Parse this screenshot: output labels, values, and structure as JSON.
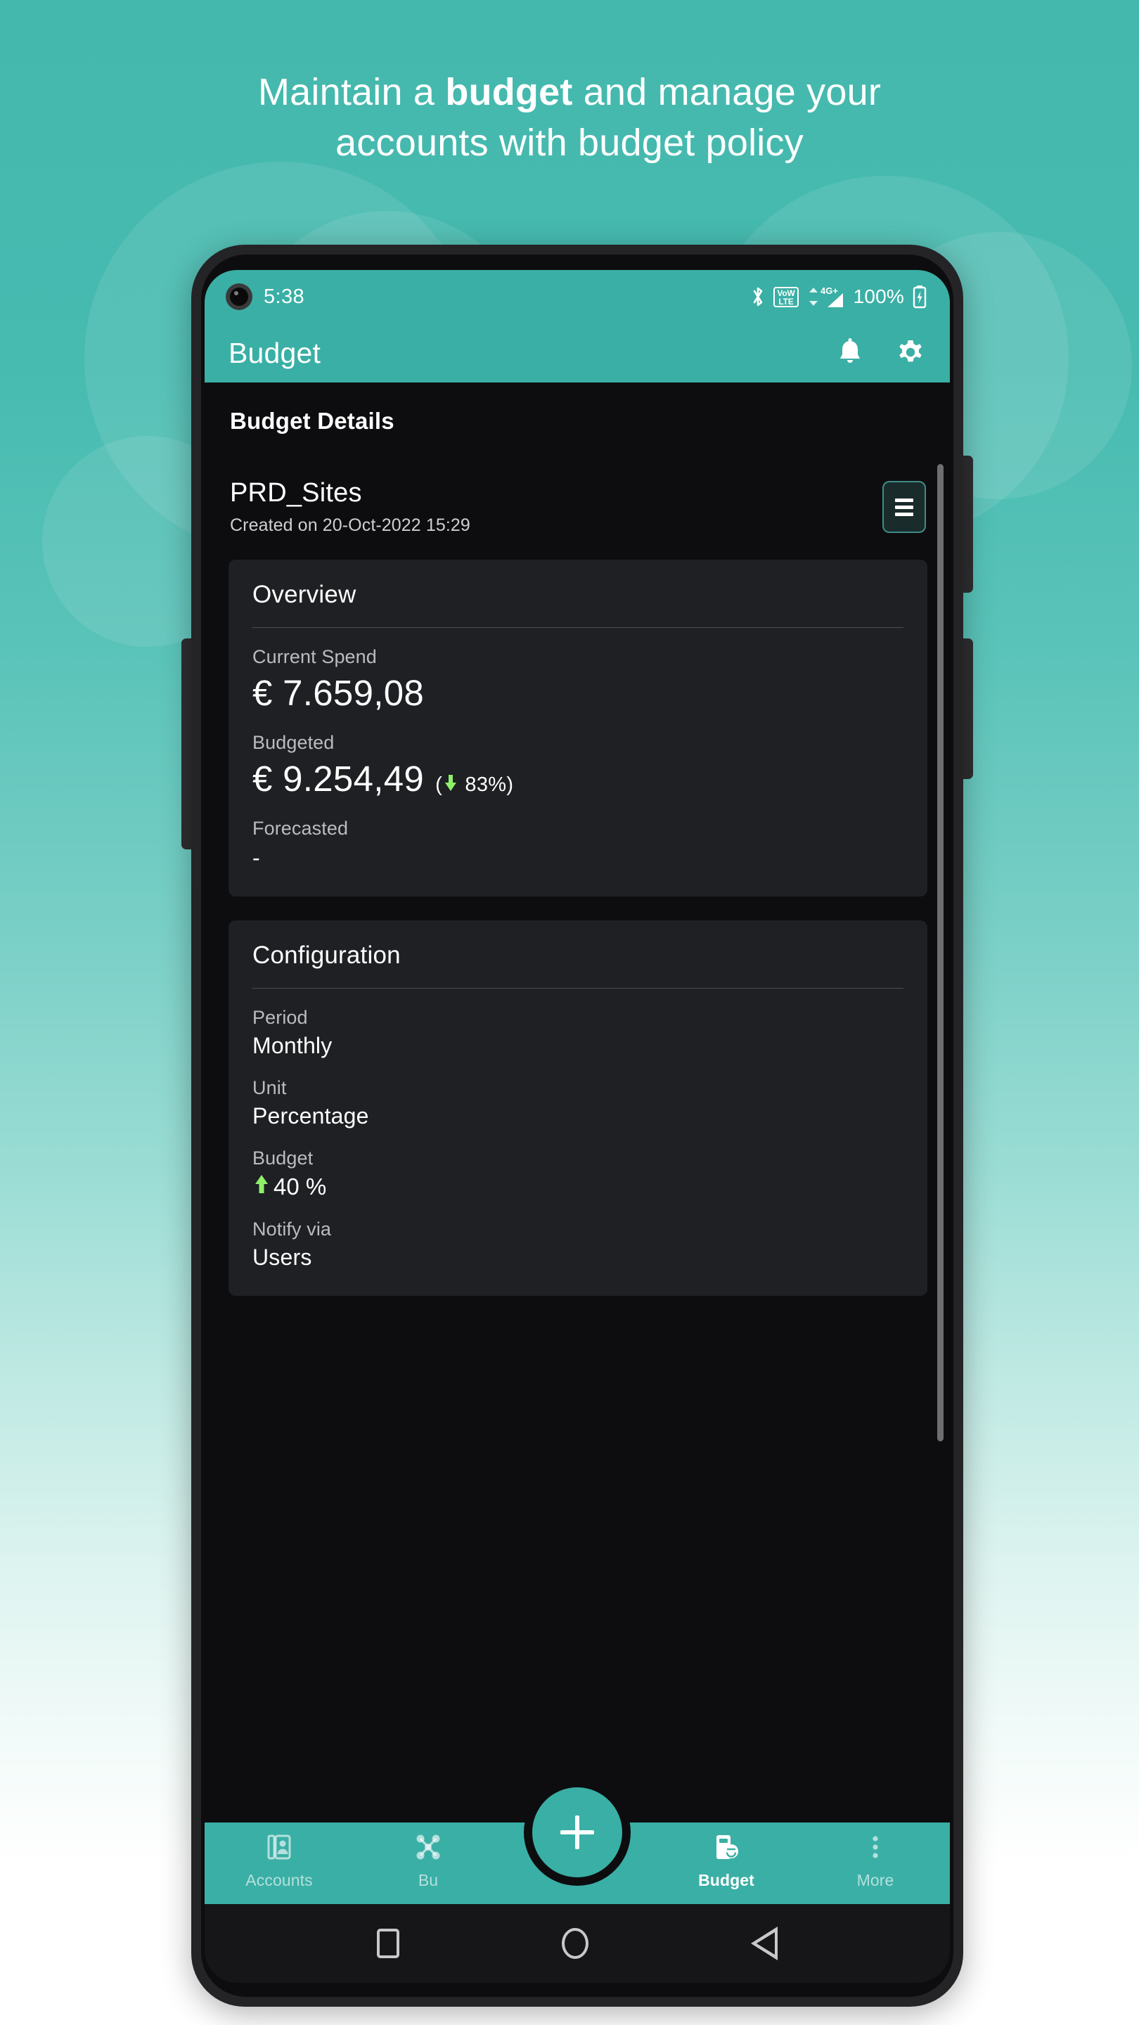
{
  "promo": {
    "headline_line1_pre": "Maintain a ",
    "headline_line1_bold": "budget",
    "headline_line1_post": " and manage your",
    "headline_line2": "accounts with budget policy"
  },
  "colors": {
    "brand_teal": "#3aafa5",
    "background_teal": "#45b8ae",
    "card_bg": "#1e2023",
    "screen_bg": "#0d0d10",
    "positive_green": "#8ef06a"
  },
  "status_bar": {
    "time": "5:38",
    "battery_percent": "100%",
    "network_label": "4G+",
    "volte_top": "VoW",
    "volte_bottom": "LTE",
    "icons": [
      "camera-hole-icon",
      "bluetooth-icon",
      "volte-icon",
      "signal-4gplus-icon",
      "battery-charging-icon"
    ]
  },
  "app_bar": {
    "title": "Budget",
    "actions": [
      {
        "name": "notifications-bell-icon",
        "label": "Notifications"
      },
      {
        "name": "settings-gear-icon",
        "label": "Settings"
      }
    ]
  },
  "screen": {
    "section_title": "Budget Details",
    "budget": {
      "name": "PRD_Sites",
      "created": "Created on 20-Oct-2022 15:29",
      "menu_button": "overflow-menu-icon"
    },
    "overview_card": {
      "title": "Overview",
      "fields": [
        {
          "label": "Current Spend",
          "value": "€ 7.659,08",
          "delta": "",
          "delta_dir": ""
        },
        {
          "label": "Budgeted",
          "value": "€ 9.254,49",
          "delta": "83%",
          "delta_dir": "down"
        },
        {
          "label": "Forecasted",
          "value": "-",
          "delta": "",
          "delta_dir": ""
        }
      ]
    },
    "configuration_card": {
      "title": "Configuration",
      "fields": [
        {
          "label": "Period",
          "value": "Monthly"
        },
        {
          "label": "Unit",
          "value": "Percentage"
        },
        {
          "label": "Budget",
          "value": "40 %",
          "arrow": "up"
        },
        {
          "label": "Notify via",
          "value": "Users"
        }
      ]
    }
  },
  "bottom_nav": {
    "items": [
      {
        "label": "Accounts",
        "icon": "accounts-card-icon",
        "active": false
      },
      {
        "label": "Bu",
        "icon": "network-nodes-icon",
        "active": false
      },
      {
        "label": "Budget",
        "icon": "budget-calculator-icon",
        "active": true
      },
      {
        "label": "More",
        "icon": "more-vertical-dots-icon",
        "active": false
      }
    ],
    "fab": {
      "label": "+",
      "name": "add-fab-button"
    }
  },
  "android_nav": {
    "recents": "recents-square-icon",
    "home": "home-circle-icon",
    "back": "back-triangle-icon"
  }
}
